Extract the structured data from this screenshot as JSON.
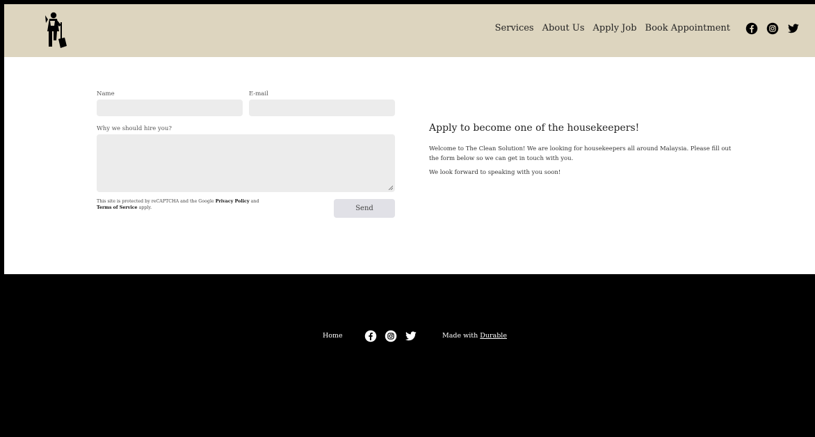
{
  "header": {
    "nav": [
      "Services",
      "About Us",
      "Apply Job",
      "Book Appointment"
    ],
    "social": [
      "facebook-icon",
      "instagram-icon",
      "twitter-icon"
    ],
    "background": "#ddd5bf"
  },
  "form": {
    "name_label": "Name",
    "email_label": "E-mail",
    "why_label": "Why we should hire you?",
    "name_value": "",
    "email_value": "",
    "why_value": "",
    "recaptcha_prefix": "This site is protected by reCAPTCHA and the Google",
    "privacy": "Privacy Policy",
    "and": "and",
    "terms": "Terms of Service",
    "apply": "apply.",
    "send": "Send"
  },
  "intro": {
    "heading": "Apply to become one of the housekeepers!",
    "paragraph1": "Welcome to The Clean Solution! We are looking for housekeepers all around Malaysia. Please fill out the form below so we can get in touch with you.",
    "paragraph2": "We look forward to speaking with you soon!"
  },
  "footer": {
    "home": "Home",
    "made_with": "Made with",
    "durable": "Durable",
    "social": [
      "facebook-icon",
      "instagram-icon",
      "twitter-icon"
    ],
    "background": "#000000"
  }
}
